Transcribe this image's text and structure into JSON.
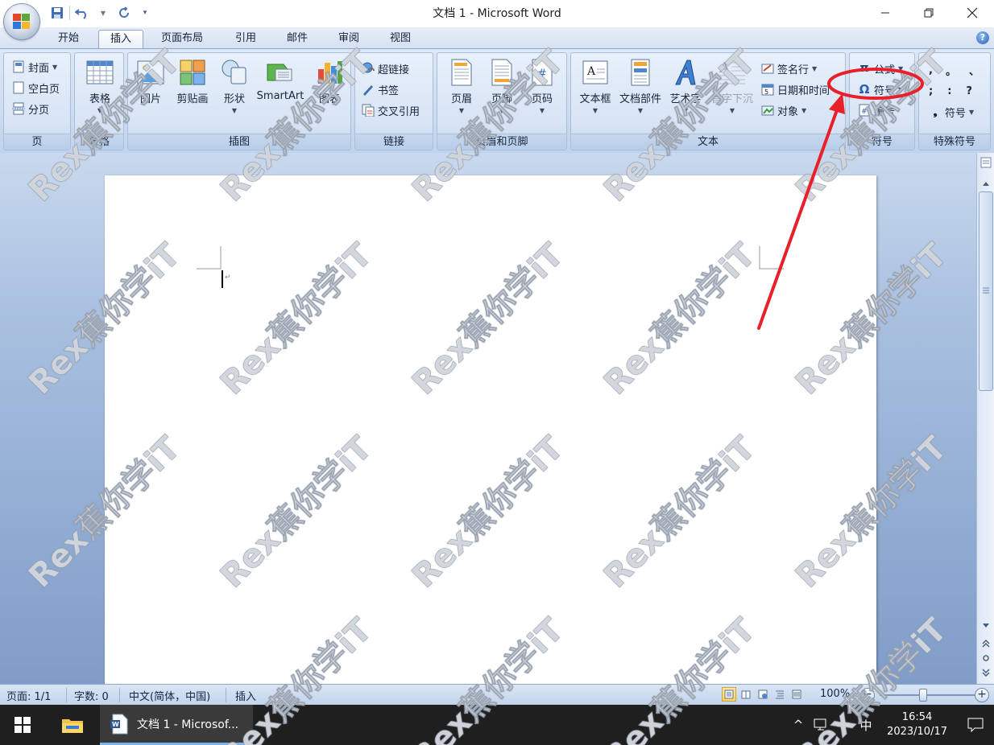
{
  "window": {
    "title": "文档 1 - Microsoft Word"
  },
  "ribbon_tabs": [
    {
      "label": "开始"
    },
    {
      "label": "插入"
    },
    {
      "label": "页面布局"
    },
    {
      "label": "引用"
    },
    {
      "label": "邮件"
    },
    {
      "label": "审阅"
    },
    {
      "label": "视图"
    }
  ],
  "groups": {
    "pages": {
      "label": "页",
      "cover": "封面",
      "blank": "空白页",
      "break": "分页"
    },
    "tables": {
      "label": "表格",
      "table": "表格"
    },
    "illustrations": {
      "label": "插图",
      "picture": "图片",
      "clipart": "剪贴画",
      "shapes": "形状",
      "smartart": "SmartArt",
      "chart": "图表"
    },
    "links": {
      "label": "链接",
      "hyperlink": "超链接",
      "bookmark": "书签",
      "crossref": "交叉引用"
    },
    "header_footer": {
      "label": "页眉和页脚",
      "header": "页眉",
      "footer": "页脚",
      "page_number": "页码"
    },
    "text": {
      "label": "文本",
      "textbox": "文本框",
      "quickparts": "文档部件",
      "wordart": "艺术字",
      "dropcap": "首字下沉",
      "signature": "签名行",
      "datetime": "日期和时间",
      "object": "对象"
    },
    "symbols": {
      "label": "符号",
      "equation": "公式",
      "symbol": "符号",
      "numbering": "编号"
    },
    "special_symbols": {
      "label": "特殊符号",
      "row1": [
        ",",
        "。",
        "、"
      ],
      "row2": [
        ";",
        ":",
        "?"
      ],
      "symbol": "符号"
    }
  },
  "statusbar": {
    "page": "页面: 1/1",
    "words": "字数: 0",
    "language": "中文(简体，中国)",
    "mode": "插入",
    "zoom": "100%",
    "zoom_percent": 100
  },
  "taskbar": {
    "word_label": "文档 1 - Microsof...",
    "ime": "中",
    "time": "16:54",
    "date": "2023/10/17"
  },
  "watermark": {
    "text": "Rex蕉你学iT"
  },
  "colors": {
    "ribbon_bg": "#cfdcef",
    "annotation_red": "#e8202a",
    "taskbar_bg": "#1f1f1f"
  }
}
